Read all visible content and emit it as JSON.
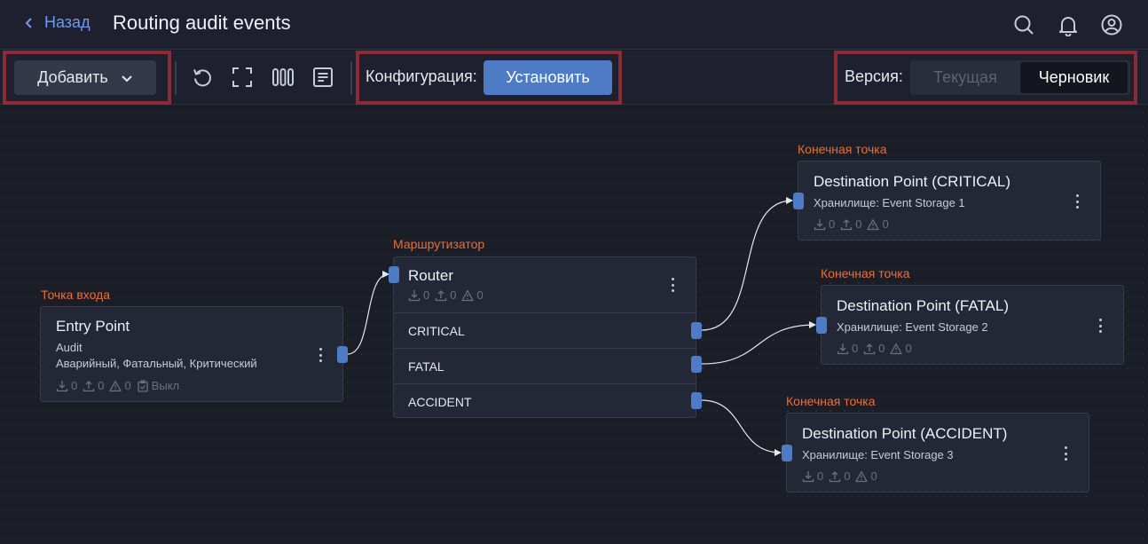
{
  "header": {
    "back_label": "Назад",
    "title": "Routing audit events"
  },
  "toolbar": {
    "add_label": "Добавить",
    "config_label": "Конфигурация:",
    "install_label": "Установить",
    "version_label": "Версия:",
    "version_current": "Текущая",
    "version_draft": "Черновик",
    "selected_version": "Черновик"
  },
  "nodes": {
    "entry": {
      "type_label": "Точка входа",
      "title": "Entry Point",
      "line1": "Audit",
      "line2": "Аварийный, Фатальный, Критический",
      "in": "0",
      "out": "0",
      "warn": "0",
      "status": "Выкл"
    },
    "router": {
      "type_label": "Маршрутизатор",
      "title": "Router",
      "in": "0",
      "out": "0",
      "warn": "0",
      "routes": [
        "CRITICAL",
        "FATAL",
        "ACCIDENT"
      ]
    },
    "dest_critical": {
      "type_label": "Конечная точка",
      "title": "Destination Point (CRITICAL)",
      "storage": "Хранилище: Event Storage 1",
      "in": "0",
      "out": "0",
      "warn": "0"
    },
    "dest_fatal": {
      "type_label": "Конечная точка",
      "title": "Destination Point (FATAL)",
      "storage": "Хранилище: Event Storage 2",
      "in": "0",
      "out": "0",
      "warn": "0"
    },
    "dest_accident": {
      "type_label": "Конечная точка",
      "title": "Destination Point (ACCIDENT)",
      "storage": "Хранилище: Event Storage 3",
      "in": "0",
      "out": "0",
      "warn": "0"
    }
  },
  "colors": {
    "accent": "#4e7bc6",
    "node_type_label": "#e9703a",
    "highlight_frame": "#8b2b35",
    "background": "#1b1d27"
  },
  "icons": {
    "back": "chevron-left-icon",
    "search": "search-icon",
    "notifications": "bell-icon",
    "account": "user-circle-icon",
    "undo": "undo-icon",
    "fit": "fit-screen-icon",
    "columns": "columns-icon",
    "log": "document-icon"
  }
}
